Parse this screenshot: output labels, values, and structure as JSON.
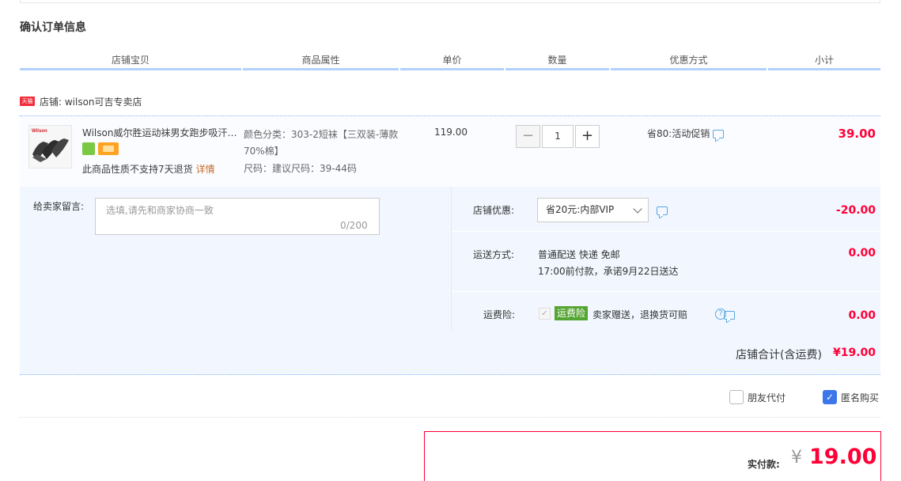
{
  "section_title": "确认订单信息",
  "columns": [
    "店铺宝贝",
    "商品属性",
    "单价",
    "数量",
    "优惠方式",
    "小计"
  ],
  "shop": {
    "badge": "天猫",
    "name": "店铺: wilson可吉专卖店"
  },
  "item": {
    "thumb_brand": "Wilson",
    "title": "Wilson威尔胜运动袜男女跑步吸汗透气短袜",
    "notice": "此商品性质不支持7天退货",
    "notice_link": "详情",
    "sku_color": "颜色分类：303-2短袜【三双装-薄款70%棉】",
    "sku_size": "尺码：建议尺码：39-44码",
    "unit_price": "119.00",
    "quantity": "1",
    "promo": "省80:活动促销",
    "subtotal": "39.00"
  },
  "message": {
    "label": "给卖家留言:",
    "placeholder": "选填,请先和商家协商一致",
    "counter": "0/200"
  },
  "shop_discount": {
    "label": "店铺优惠:",
    "selected": "省20元:内部VIP",
    "amount": "-20.00"
  },
  "shipping": {
    "label": "运送方式:",
    "method": "普通配送 快递 免邮",
    "promise": "17:00前付款，承诺9月22日送达",
    "amount": "0.00"
  },
  "insurance": {
    "label": "运费险:",
    "tag": "运费险",
    "desc": "卖家赠送，退换货可赔",
    "help": "?",
    "amount": "0.00"
  },
  "shop_total": {
    "label": "店铺合计(含运费)",
    "value": "¥19.00"
  },
  "options": {
    "friend_pay": "朋友代付",
    "anonymous": "匿名购买",
    "anonymous_checked": true
  },
  "payment": {
    "label": "实付款:",
    "currency": "¥",
    "amount": "19.00"
  },
  "colors": {
    "price_red": "#ff0036",
    "header_blue": "#b2d1ff",
    "panel_bg": "#f2f7ff",
    "insurance_green": "#55a532"
  }
}
